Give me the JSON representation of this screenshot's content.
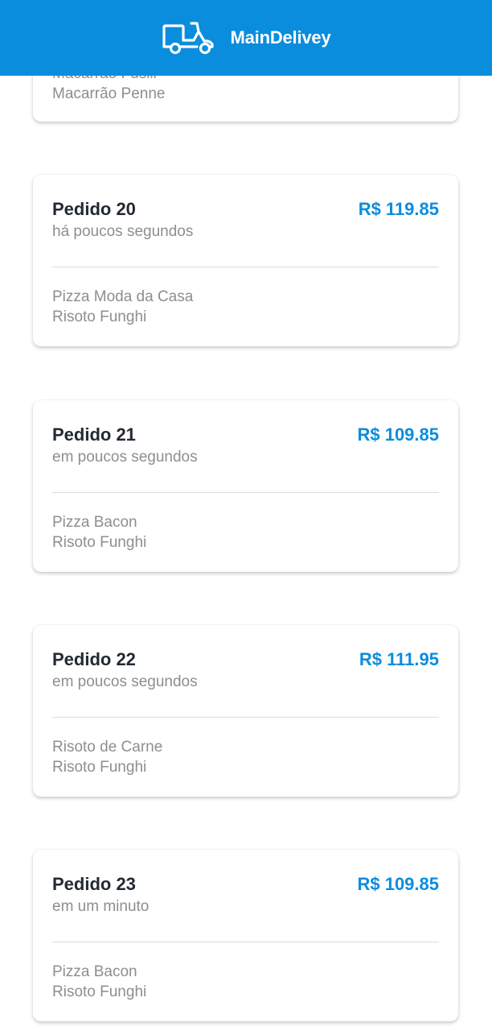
{
  "app": {
    "title": "MainDelivey",
    "logo_icon": "delivery-scooter-icon",
    "header_color": "#0b8ddd"
  },
  "colors": {
    "accent": "#0b8ddd",
    "title_text": "#222a33",
    "muted_text": "#8e8e8e"
  },
  "partial_order": {
    "items": [
      "Macarrão Fusili",
      "Macarrão Penne"
    ]
  },
  "orders": [
    {
      "title": "Pedido 20",
      "time": "há poucos segundos",
      "price": "R$ 119.85",
      "items": [
        "Pizza Moda da Casa",
        "Risoto Funghi"
      ]
    },
    {
      "title": "Pedido 21",
      "time": "em poucos segundos",
      "price": "R$ 109.85",
      "items": [
        "Pizza Bacon",
        "Risoto Funghi"
      ]
    },
    {
      "title": "Pedido 22",
      "time": "em poucos segundos",
      "price": "R$ 111.95",
      "items": [
        "Risoto de Carne",
        "Risoto Funghi"
      ]
    },
    {
      "title": "Pedido 23",
      "time": "em um minuto",
      "price": "R$ 109.85",
      "items": [
        "Pizza Bacon",
        "Risoto Funghi"
      ]
    }
  ]
}
